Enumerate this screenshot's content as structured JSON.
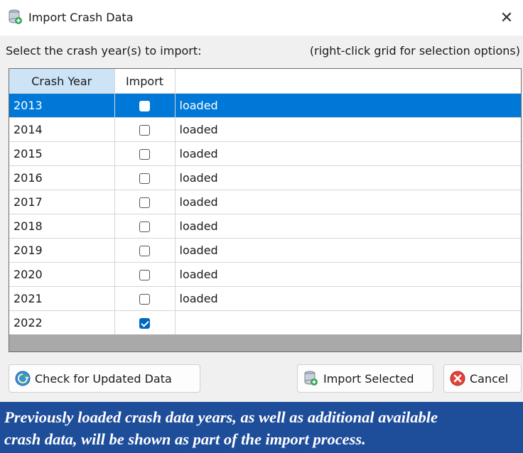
{
  "window": {
    "title": "Import Crash Data",
    "icon": "database-import-icon",
    "close_glyph": "✕"
  },
  "instructions": {
    "left": "Select the crash year(s) to import:",
    "right": "(right-click grid for selection options)"
  },
  "grid": {
    "headers": [
      "Crash Year",
      "Import",
      ""
    ],
    "rows": [
      {
        "year": "2013",
        "checked": false,
        "status": "loaded",
        "selected": true
      },
      {
        "year": "2014",
        "checked": false,
        "status": "loaded",
        "selected": false
      },
      {
        "year": "2015",
        "checked": false,
        "status": "loaded",
        "selected": false
      },
      {
        "year": "2016",
        "checked": false,
        "status": "loaded",
        "selected": false
      },
      {
        "year": "2017",
        "checked": false,
        "status": "loaded",
        "selected": false
      },
      {
        "year": "2018",
        "checked": false,
        "status": "loaded",
        "selected": false
      },
      {
        "year": "2019",
        "checked": false,
        "status": "loaded",
        "selected": false
      },
      {
        "year": "2020",
        "checked": false,
        "status": "loaded",
        "selected": false
      },
      {
        "year": "2021",
        "checked": false,
        "status": "loaded",
        "selected": false
      },
      {
        "year": "2022",
        "checked": true,
        "status": "",
        "selected": false
      }
    ]
  },
  "buttons": {
    "check_updates": {
      "label": "Check for Updated Data",
      "icon": "globe-refresh-icon"
    },
    "import_selected": {
      "label": "Import Selected",
      "icon": "database-import-icon"
    },
    "cancel": {
      "label": "Cancel",
      "icon": "cancel-icon"
    }
  },
  "caption": {
    "line1": "Previously loaded crash data years, as well as additional available",
    "line2": "crash data, will be shown as part of the import process."
  },
  "colors": {
    "selection": "#0078d7",
    "header_sorted": "#cde4f7",
    "caption_bg": "#1e4d9a",
    "checkbox_checked": "#0067c0",
    "cancel_red": "#e0453a"
  }
}
